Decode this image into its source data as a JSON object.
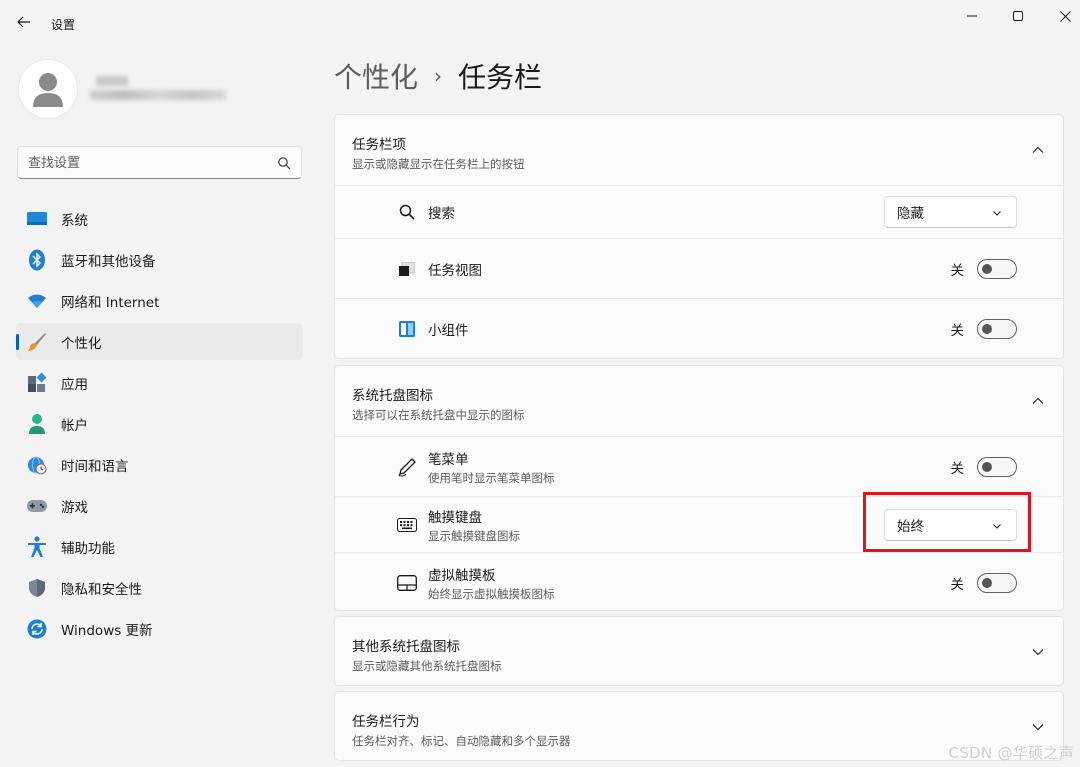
{
  "window": {
    "title": "设置",
    "controls": [
      "minimize-icon",
      "maximize-icon",
      "close-icon"
    ]
  },
  "sidebar": {
    "search_placeholder": "查找设置",
    "items": [
      {
        "label": "系统",
        "icon": "system-display-icon",
        "active": false
      },
      {
        "label": "蓝牙和其他设备",
        "icon": "bluetooth-icon",
        "active": false
      },
      {
        "label": "网络和 Internet",
        "icon": "wifi-icon",
        "active": false
      },
      {
        "label": "个性化",
        "icon": "paintbrush-icon",
        "active": true
      },
      {
        "label": "应用",
        "icon": "apps-icon",
        "active": false
      },
      {
        "label": "帐户",
        "icon": "account-icon",
        "active": false
      },
      {
        "label": "时间和语言",
        "icon": "globe-clock-icon",
        "active": false
      },
      {
        "label": "游戏",
        "icon": "gamepad-icon",
        "active": false
      },
      {
        "label": "辅助功能",
        "icon": "accessibility-icon",
        "active": false
      },
      {
        "label": "隐私和安全性",
        "icon": "shield-icon",
        "active": false
      },
      {
        "label": "Windows 更新",
        "icon": "update-icon",
        "active": false
      }
    ]
  },
  "breadcrumb": {
    "parent": "个性化",
    "separator": "›",
    "current": "任务栏"
  },
  "sections": {
    "taskbar_items": {
      "title": "任务栏项",
      "subtitle": "显示或隐藏显示在任务栏上的按钮",
      "expanded": true,
      "rows": {
        "search": {
          "label": "搜索",
          "value": "隐藏"
        },
        "task_view": {
          "label": "任务视图",
          "state": "关"
        },
        "widgets": {
          "label": "小组件",
          "state": "关"
        }
      }
    },
    "tray_icons": {
      "title": "系统托盘图标",
      "subtitle": "选择可以在系统托盘中显示的图标",
      "expanded": true,
      "rows": {
        "pen_menu": {
          "label": "笔菜单",
          "sub": "使用笔时显示笔菜单图标",
          "state": "关"
        },
        "touch_keyboard": {
          "label": "触摸键盘",
          "sub": "显示触摸键盘图标",
          "value": "始终"
        },
        "virtual_touchpad": {
          "label": "虚拟触摸板",
          "sub": "始终显示虚拟触摸板图标",
          "state": "关"
        }
      }
    },
    "other_tray": {
      "title": "其他系统托盘图标",
      "subtitle": "显示或隐藏其他系统托盘图标",
      "expanded": false
    },
    "behaviors": {
      "title": "任务栏行为",
      "subtitle": "任务栏对齐、标记、自动隐藏和多个显示器",
      "expanded": false
    }
  },
  "colors": {
    "accent": "#005fb8",
    "highlight_box": "#e0141a"
  },
  "watermark": "CSDN @华硕之声"
}
